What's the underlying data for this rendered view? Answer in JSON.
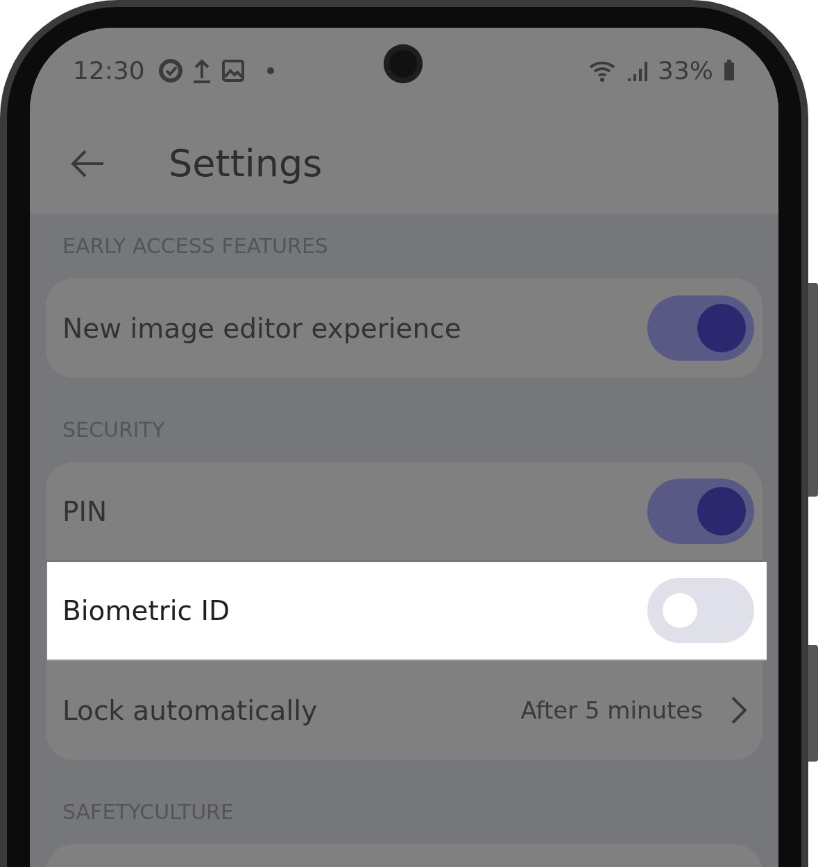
{
  "status_bar": {
    "time": "12:30",
    "battery": "33%"
  },
  "header": {
    "title": "Settings"
  },
  "sections": [
    {
      "title": "EARLY ACCESS FEATURES",
      "rows": [
        {
          "kind": "toggle",
          "label": "New image editor experience",
          "on": true,
          "highlighted": false
        }
      ]
    },
    {
      "title": "SECURITY",
      "rows": [
        {
          "kind": "toggle",
          "label": "PIN",
          "on": true,
          "highlighted": false
        },
        {
          "kind": "toggle",
          "label": "Biometric ID",
          "on": false,
          "highlighted": true
        },
        {
          "kind": "link",
          "label": "Lock automatically",
          "value": "After 5 minutes",
          "highlighted": false
        }
      ]
    },
    {
      "title": "SAFETYCULTURE"
    }
  ]
}
